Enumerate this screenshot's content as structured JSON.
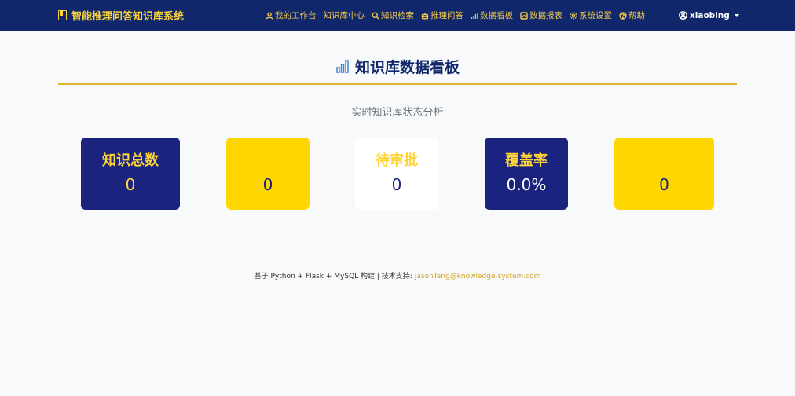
{
  "navbar": {
    "brand": "智能推理问答知识库系统",
    "items": [
      {
        "label": "我的工作台",
        "icon": "user-icon"
      },
      {
        "label": "知识库中心",
        "icon": ""
      },
      {
        "label": "知识检索",
        "icon": "search-icon"
      },
      {
        "label": "推理问答",
        "icon": "robot-icon"
      },
      {
        "label": "数据看板",
        "icon": "bar-chart-icon"
      },
      {
        "label": "数据报表",
        "icon": "report-icon"
      },
      {
        "label": "系统设置",
        "icon": "gear-icon"
      },
      {
        "label": "帮助",
        "icon": "help-icon"
      }
    ],
    "user": "xiaobing"
  },
  "page": {
    "title": "知识库数据看板",
    "subtitle": "实时知识库状态分析"
  },
  "stats": [
    {
      "label": "知识总数",
      "value": "0",
      "style": "navy"
    },
    {
      "label": "",
      "value": "0",
      "style": "yellow"
    },
    {
      "label": "待审批",
      "value": "0",
      "style": "white"
    },
    {
      "label": "覆盖率",
      "value": "0.0%",
      "style": "navy"
    },
    {
      "label": "",
      "value": "0",
      "style": "yellow"
    }
  ],
  "footer": {
    "text": "基于 Python + Flask + MySQL 构建 | 技术支持: ",
    "email": "JasonTang@knowledge-system.com"
  },
  "colors": {
    "navbar": "#10286b",
    "accent_yellow": "#ffd700",
    "navy": "#1a237e",
    "rule": "#e0b22a"
  }
}
